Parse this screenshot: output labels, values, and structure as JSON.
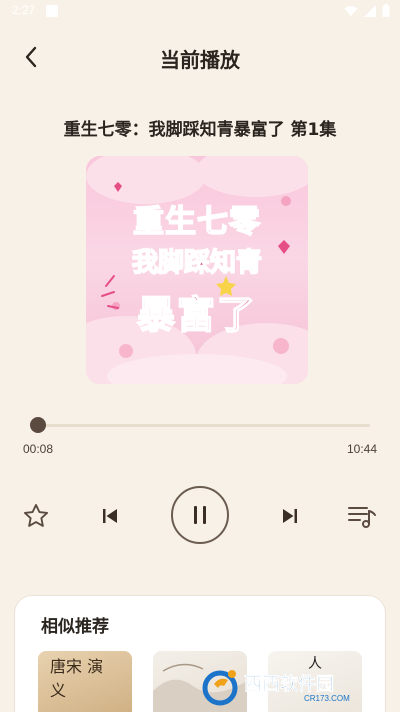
{
  "status_bar": {
    "time": "2:27"
  },
  "header": {
    "title": "当前播放"
  },
  "episode": {
    "title": "重生七零：我脚踩知青暴富了 第1集"
  },
  "cover": {
    "line1": "重生七零",
    "line2": "我脚踩知青",
    "line3": "暴富了"
  },
  "player": {
    "elapsed": "00:08",
    "total": "10:44",
    "progress_fraction": 0.012,
    "state": "playing"
  },
  "controls": {
    "favorite_icon": "star-outline-icon",
    "prev_icon": "skip-previous-icon",
    "pause_icon": "pause-icon",
    "next_icon": "skip-next-icon",
    "playlist_icon": "playlist-music-icon"
  },
  "recommend": {
    "title": "相似推荐",
    "items": [
      {
        "thumb_text": "唐宋 演义"
      },
      {
        "thumb_text": ""
      },
      {
        "thumb_text": "人"
      }
    ]
  },
  "watermark": {
    "main": "西西软件园",
    "sub": "CR173.COM"
  },
  "colors": {
    "background": "#f8f1e7",
    "accent": "#5a4a3f",
    "cover_pink": "#f9c7db",
    "watermark_blue": "#1b74c9"
  }
}
